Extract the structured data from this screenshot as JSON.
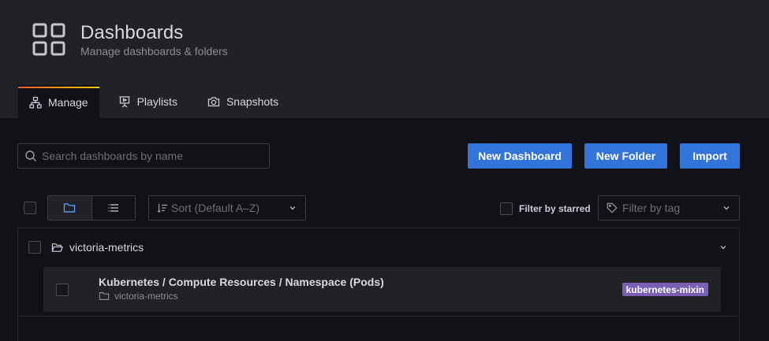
{
  "header": {
    "title": "Dashboards",
    "subtitle": "Manage dashboards & folders",
    "icon": "dashboard-grid-icon"
  },
  "tabs": [
    {
      "label": "Manage",
      "icon": "sitemap-icon",
      "active": true
    },
    {
      "label": "Playlists",
      "icon": "presentation-icon",
      "active": false
    },
    {
      "label": "Snapshots",
      "icon": "camera-icon",
      "active": false
    }
  ],
  "toolbar": {
    "search_placeholder": "Search dashboards by name",
    "new_dashboard_label": "New Dashboard",
    "new_folder_label": "New Folder",
    "import_label": "Import"
  },
  "filters": {
    "sort_placeholder": "Sort (Default A–Z)",
    "starred_label": "Filter by starred",
    "tag_placeholder": "Filter by tag"
  },
  "list": {
    "folder_name": "victoria-metrics",
    "dashboards": [
      {
        "title": "Kubernetes / Compute Resources / Namespace (Pods)",
        "folder": "victoria-metrics",
        "tag": "kubernetes-mixin"
      }
    ]
  },
  "colors": {
    "primary_button": "#3274d9",
    "tag_background": "#7a5fb3",
    "active_tab_gradient_start": "#f05a28",
    "active_tab_gradient_end": "#fbca0a"
  }
}
